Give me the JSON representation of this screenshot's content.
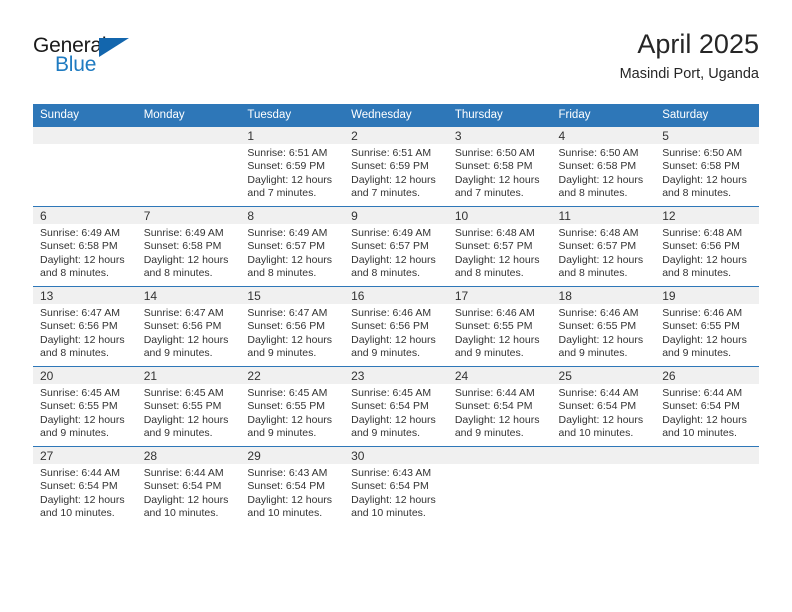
{
  "brand": {
    "name_part1": "General",
    "name_part2": "Blue",
    "accent_color": "#1366ad",
    "blue_text_color": "#1f7bc1"
  },
  "header": {
    "title": "April 2025",
    "subtitle": "Masindi Port, Uganda",
    "header_bg_color": "#2e77b8",
    "daynum_band_color": "#f0f0f0"
  },
  "weekday_headers": [
    "Sunday",
    "Monday",
    "Tuesday",
    "Wednesday",
    "Thursday",
    "Friday",
    "Saturday"
  ],
  "weeks": [
    [
      {
        "day": "",
        "sunrise": "",
        "sunset": "",
        "daylight_line1": "",
        "daylight_line2": ""
      },
      {
        "day": "",
        "sunrise": "",
        "sunset": "",
        "daylight_line1": "",
        "daylight_line2": ""
      },
      {
        "day": "1",
        "sunrise": "Sunrise: 6:51 AM",
        "sunset": "Sunset: 6:59 PM",
        "daylight_line1": "Daylight: 12 hours",
        "daylight_line2": "and 7 minutes."
      },
      {
        "day": "2",
        "sunrise": "Sunrise: 6:51 AM",
        "sunset": "Sunset: 6:59 PM",
        "daylight_line1": "Daylight: 12 hours",
        "daylight_line2": "and 7 minutes."
      },
      {
        "day": "3",
        "sunrise": "Sunrise: 6:50 AM",
        "sunset": "Sunset: 6:58 PM",
        "daylight_line1": "Daylight: 12 hours",
        "daylight_line2": "and 7 minutes."
      },
      {
        "day": "4",
        "sunrise": "Sunrise: 6:50 AM",
        "sunset": "Sunset: 6:58 PM",
        "daylight_line1": "Daylight: 12 hours",
        "daylight_line2": "and 8 minutes."
      },
      {
        "day": "5",
        "sunrise": "Sunrise: 6:50 AM",
        "sunset": "Sunset: 6:58 PM",
        "daylight_line1": "Daylight: 12 hours",
        "daylight_line2": "and 8 minutes."
      }
    ],
    [
      {
        "day": "6",
        "sunrise": "Sunrise: 6:49 AM",
        "sunset": "Sunset: 6:58 PM",
        "daylight_line1": "Daylight: 12 hours",
        "daylight_line2": "and 8 minutes."
      },
      {
        "day": "7",
        "sunrise": "Sunrise: 6:49 AM",
        "sunset": "Sunset: 6:58 PM",
        "daylight_line1": "Daylight: 12 hours",
        "daylight_line2": "and 8 minutes."
      },
      {
        "day": "8",
        "sunrise": "Sunrise: 6:49 AM",
        "sunset": "Sunset: 6:57 PM",
        "daylight_line1": "Daylight: 12 hours",
        "daylight_line2": "and 8 minutes."
      },
      {
        "day": "9",
        "sunrise": "Sunrise: 6:49 AM",
        "sunset": "Sunset: 6:57 PM",
        "daylight_line1": "Daylight: 12 hours",
        "daylight_line2": "and 8 minutes."
      },
      {
        "day": "10",
        "sunrise": "Sunrise: 6:48 AM",
        "sunset": "Sunset: 6:57 PM",
        "daylight_line1": "Daylight: 12 hours",
        "daylight_line2": "and 8 minutes."
      },
      {
        "day": "11",
        "sunrise": "Sunrise: 6:48 AM",
        "sunset": "Sunset: 6:57 PM",
        "daylight_line1": "Daylight: 12 hours",
        "daylight_line2": "and 8 minutes."
      },
      {
        "day": "12",
        "sunrise": "Sunrise: 6:48 AM",
        "sunset": "Sunset: 6:56 PM",
        "daylight_line1": "Daylight: 12 hours",
        "daylight_line2": "and 8 minutes."
      }
    ],
    [
      {
        "day": "13",
        "sunrise": "Sunrise: 6:47 AM",
        "sunset": "Sunset: 6:56 PM",
        "daylight_line1": "Daylight: 12 hours",
        "daylight_line2": "and 8 minutes."
      },
      {
        "day": "14",
        "sunrise": "Sunrise: 6:47 AM",
        "sunset": "Sunset: 6:56 PM",
        "daylight_line1": "Daylight: 12 hours",
        "daylight_line2": "and 9 minutes."
      },
      {
        "day": "15",
        "sunrise": "Sunrise: 6:47 AM",
        "sunset": "Sunset: 6:56 PM",
        "daylight_line1": "Daylight: 12 hours",
        "daylight_line2": "and 9 minutes."
      },
      {
        "day": "16",
        "sunrise": "Sunrise: 6:46 AM",
        "sunset": "Sunset: 6:56 PM",
        "daylight_line1": "Daylight: 12 hours",
        "daylight_line2": "and 9 minutes."
      },
      {
        "day": "17",
        "sunrise": "Sunrise: 6:46 AM",
        "sunset": "Sunset: 6:55 PM",
        "daylight_line1": "Daylight: 12 hours",
        "daylight_line2": "and 9 minutes."
      },
      {
        "day": "18",
        "sunrise": "Sunrise: 6:46 AM",
        "sunset": "Sunset: 6:55 PM",
        "daylight_line1": "Daylight: 12 hours",
        "daylight_line2": "and 9 minutes."
      },
      {
        "day": "19",
        "sunrise": "Sunrise: 6:46 AM",
        "sunset": "Sunset: 6:55 PM",
        "daylight_line1": "Daylight: 12 hours",
        "daylight_line2": "and 9 minutes."
      }
    ],
    [
      {
        "day": "20",
        "sunrise": "Sunrise: 6:45 AM",
        "sunset": "Sunset: 6:55 PM",
        "daylight_line1": "Daylight: 12 hours",
        "daylight_line2": "and 9 minutes."
      },
      {
        "day": "21",
        "sunrise": "Sunrise: 6:45 AM",
        "sunset": "Sunset: 6:55 PM",
        "daylight_line1": "Daylight: 12 hours",
        "daylight_line2": "and 9 minutes."
      },
      {
        "day": "22",
        "sunrise": "Sunrise: 6:45 AM",
        "sunset": "Sunset: 6:55 PM",
        "daylight_line1": "Daylight: 12 hours",
        "daylight_line2": "and 9 minutes."
      },
      {
        "day": "23",
        "sunrise": "Sunrise: 6:45 AM",
        "sunset": "Sunset: 6:54 PM",
        "daylight_line1": "Daylight: 12 hours",
        "daylight_line2": "and 9 minutes."
      },
      {
        "day": "24",
        "sunrise": "Sunrise: 6:44 AM",
        "sunset": "Sunset: 6:54 PM",
        "daylight_line1": "Daylight: 12 hours",
        "daylight_line2": "and 9 minutes."
      },
      {
        "day": "25",
        "sunrise": "Sunrise: 6:44 AM",
        "sunset": "Sunset: 6:54 PM",
        "daylight_line1": "Daylight: 12 hours",
        "daylight_line2": "and 10 minutes."
      },
      {
        "day": "26",
        "sunrise": "Sunrise: 6:44 AM",
        "sunset": "Sunset: 6:54 PM",
        "daylight_line1": "Daylight: 12 hours",
        "daylight_line2": "and 10 minutes."
      }
    ],
    [
      {
        "day": "27",
        "sunrise": "Sunrise: 6:44 AM",
        "sunset": "Sunset: 6:54 PM",
        "daylight_line1": "Daylight: 12 hours",
        "daylight_line2": "and 10 minutes."
      },
      {
        "day": "28",
        "sunrise": "Sunrise: 6:44 AM",
        "sunset": "Sunset: 6:54 PM",
        "daylight_line1": "Daylight: 12 hours",
        "daylight_line2": "and 10 minutes."
      },
      {
        "day": "29",
        "sunrise": "Sunrise: 6:43 AM",
        "sunset": "Sunset: 6:54 PM",
        "daylight_line1": "Daylight: 12 hours",
        "daylight_line2": "and 10 minutes."
      },
      {
        "day": "30",
        "sunrise": "Sunrise: 6:43 AM",
        "sunset": "Sunset: 6:54 PM",
        "daylight_line1": "Daylight: 12 hours",
        "daylight_line2": "and 10 minutes."
      },
      {
        "day": "",
        "sunrise": "",
        "sunset": "",
        "daylight_line1": "",
        "daylight_line2": ""
      },
      {
        "day": "",
        "sunrise": "",
        "sunset": "",
        "daylight_line1": "",
        "daylight_line2": ""
      },
      {
        "day": "",
        "sunrise": "",
        "sunset": "",
        "daylight_line1": "",
        "daylight_line2": ""
      }
    ]
  ]
}
